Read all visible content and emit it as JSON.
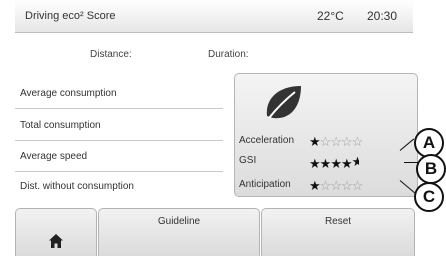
{
  "header": {
    "title": "Driving eco² Score",
    "temperature": "22°C",
    "time": "20:30"
  },
  "summary": {
    "distance_label": "Distance:",
    "duration_label": "Duration:"
  },
  "metrics": [
    {
      "label": "Average consumption"
    },
    {
      "label": "Total consumption"
    },
    {
      "label": "Average speed"
    },
    {
      "label": "Dist. without consumption"
    }
  ],
  "score_panel": {
    "icon": "leaf-icon",
    "scores": [
      {
        "label": "Acceleration",
        "stars": 1,
        "max": 5
      },
      {
        "label": "GSI",
        "stars": 4.5,
        "max": 5
      },
      {
        "label": "Anticipation",
        "stars": 1,
        "max": 5
      }
    ]
  },
  "callouts": [
    "A",
    "B",
    "C"
  ],
  "bottom_bar": {
    "home_icon": "home-icon",
    "guideline_label": "Guideline",
    "reset_label": "Reset"
  },
  "colors": {
    "callout": "#111111",
    "leaf": "#333333"
  }
}
